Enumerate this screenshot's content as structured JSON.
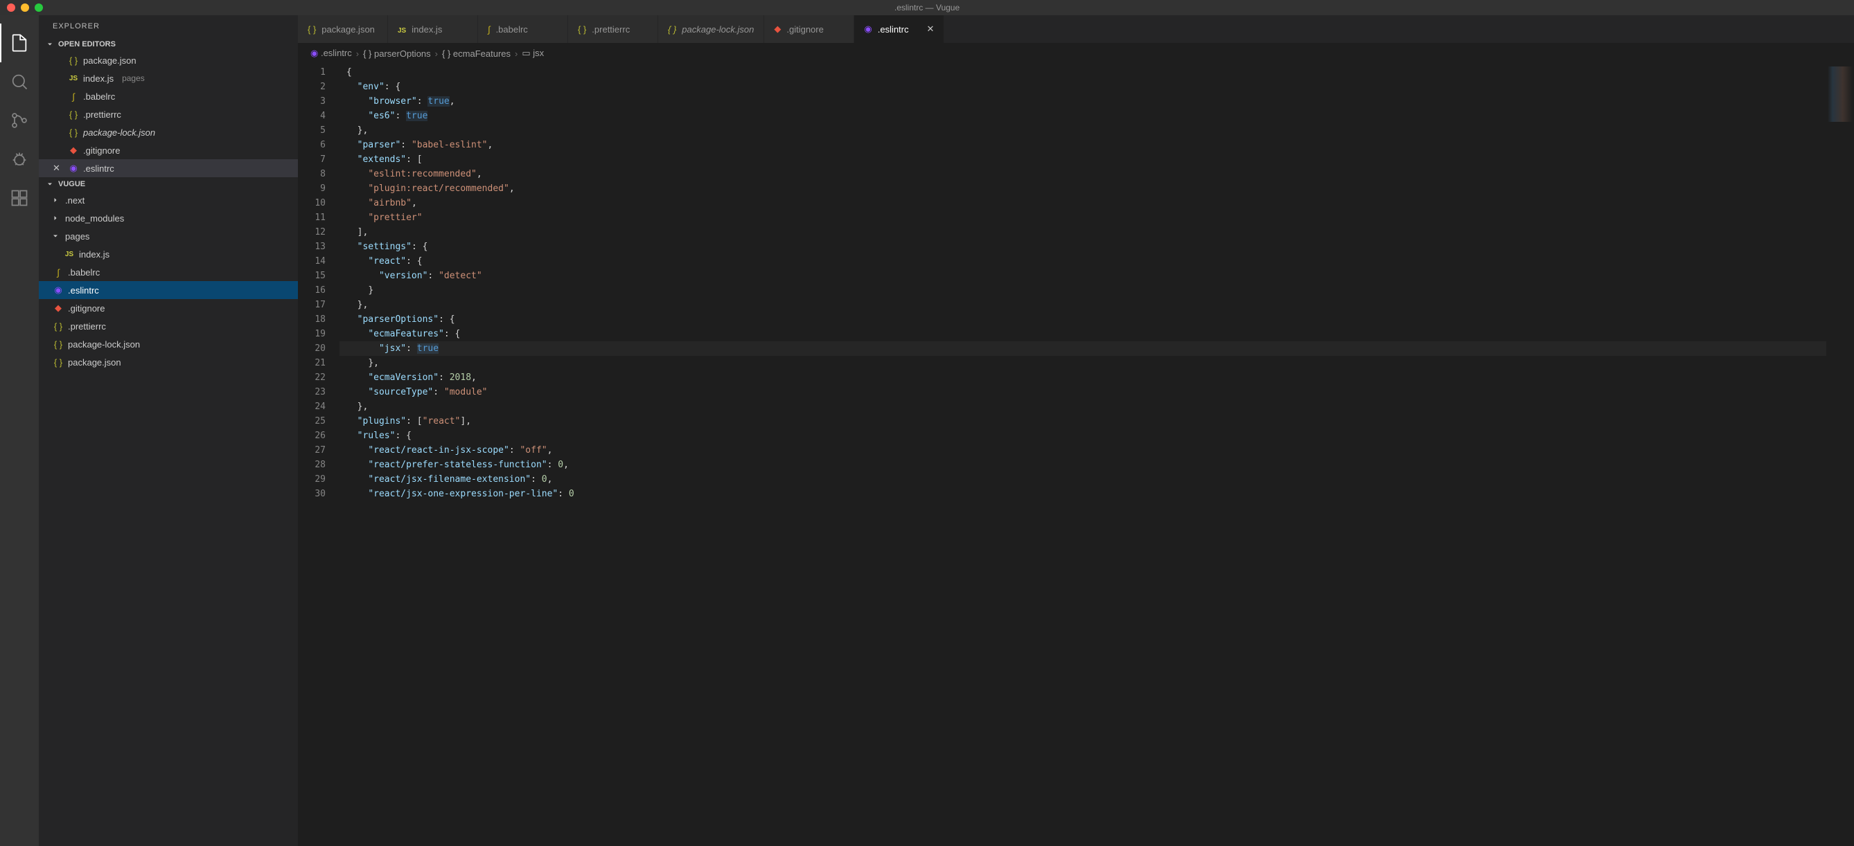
{
  "titlebar": {
    "title": ".eslintrc — Vugue"
  },
  "sidebar": {
    "header": "EXPLORER",
    "sections": {
      "openEditors": {
        "label": "OPEN EDITORS",
        "items": [
          {
            "name": "package.json",
            "iconType": "json"
          },
          {
            "name": "index.js",
            "iconType": "js",
            "hint": "pages"
          },
          {
            "name": ".babelrc",
            "iconType": "babel"
          },
          {
            "name": ".prettierrc",
            "iconType": "json"
          },
          {
            "name": "package-lock.json",
            "iconType": "json",
            "italic": true
          },
          {
            "name": ".gitignore",
            "iconType": "git"
          },
          {
            "name": ".eslintrc",
            "iconType": "eslint",
            "active": true
          }
        ]
      },
      "project": {
        "label": "VUGUE",
        "items": [
          {
            "name": ".next",
            "type": "folder",
            "expanded": false
          },
          {
            "name": "node_modules",
            "type": "folder",
            "expanded": false
          },
          {
            "name": "pages",
            "type": "folder",
            "expanded": true
          },
          {
            "name": "index.js",
            "type": "file",
            "iconType": "js",
            "nested": true
          },
          {
            "name": ".babelrc",
            "type": "file",
            "iconType": "babel"
          },
          {
            "name": ".eslintrc",
            "type": "file",
            "iconType": "eslint",
            "selected": true
          },
          {
            "name": ".gitignore",
            "type": "file",
            "iconType": "git"
          },
          {
            "name": ".prettierrc",
            "type": "file",
            "iconType": "json"
          },
          {
            "name": "package-lock.json",
            "type": "file",
            "iconType": "json"
          },
          {
            "name": "package.json",
            "type": "file",
            "iconType": "json"
          }
        ]
      }
    }
  },
  "tabs": [
    {
      "name": "package.json",
      "iconType": "json"
    },
    {
      "name": "index.js",
      "iconType": "js"
    },
    {
      "name": ".babelrc",
      "iconType": "babel"
    },
    {
      "name": ".prettierrc",
      "iconType": "json"
    },
    {
      "name": "package-lock.json",
      "iconType": "json",
      "italic": true
    },
    {
      "name": ".gitignore",
      "iconType": "git"
    },
    {
      "name": ".eslintrc",
      "iconType": "eslint",
      "active": true
    }
  ],
  "breadcrumbs": [
    {
      "label": ".eslintrc",
      "icon": "eslint"
    },
    {
      "label": "parserOptions",
      "icon": "braces"
    },
    {
      "label": "ecmaFeatures",
      "icon": "braces"
    },
    {
      "label": "jsx",
      "icon": "field"
    }
  ],
  "editor": {
    "currentLine": 20,
    "lines": [
      {
        "n": 1,
        "segs": [
          [
            "{",
            "brace"
          ]
        ]
      },
      {
        "n": 2,
        "segs": [
          [
            "  ",
            ""
          ],
          [
            "\"env\"",
            "key"
          ],
          [
            ": ",
            "punc"
          ],
          [
            "{",
            "brace"
          ]
        ]
      },
      {
        "n": 3,
        "segs": [
          [
            "    ",
            ""
          ],
          [
            "\"browser\"",
            "key"
          ],
          [
            ": ",
            "punc"
          ],
          [
            "true",
            "bool"
          ],
          [
            ",",
            "punc"
          ]
        ]
      },
      {
        "n": 4,
        "segs": [
          [
            "    ",
            ""
          ],
          [
            "\"es6\"",
            "key"
          ],
          [
            ": ",
            "punc"
          ],
          [
            "true",
            "bool"
          ]
        ]
      },
      {
        "n": 5,
        "segs": [
          [
            "  ",
            ""
          ],
          [
            "},",
            "brace"
          ]
        ]
      },
      {
        "n": 6,
        "segs": [
          [
            "  ",
            ""
          ],
          [
            "\"parser\"",
            "key"
          ],
          [
            ": ",
            "punc"
          ],
          [
            "\"babel-eslint\"",
            "str"
          ],
          [
            ",",
            "punc"
          ]
        ]
      },
      {
        "n": 7,
        "segs": [
          [
            "  ",
            ""
          ],
          [
            "\"extends\"",
            "key"
          ],
          [
            ": ",
            "punc"
          ],
          [
            "[",
            "brace"
          ]
        ]
      },
      {
        "n": 8,
        "segs": [
          [
            "    ",
            ""
          ],
          [
            "\"eslint:recommended\"",
            "str"
          ],
          [
            ",",
            "punc"
          ]
        ]
      },
      {
        "n": 9,
        "segs": [
          [
            "    ",
            ""
          ],
          [
            "\"plugin:react/recommended\"",
            "str"
          ],
          [
            ",",
            "punc"
          ]
        ]
      },
      {
        "n": 10,
        "segs": [
          [
            "    ",
            ""
          ],
          [
            "\"airbnb\"",
            "str"
          ],
          [
            ",",
            "punc"
          ]
        ]
      },
      {
        "n": 11,
        "segs": [
          [
            "    ",
            ""
          ],
          [
            "\"prettier\"",
            "str"
          ]
        ]
      },
      {
        "n": 12,
        "segs": [
          [
            "  ",
            ""
          ],
          [
            "],",
            "brace"
          ]
        ]
      },
      {
        "n": 13,
        "segs": [
          [
            "  ",
            ""
          ],
          [
            "\"settings\"",
            "key"
          ],
          [
            ": ",
            "punc"
          ],
          [
            "{",
            "brace"
          ]
        ]
      },
      {
        "n": 14,
        "segs": [
          [
            "    ",
            ""
          ],
          [
            "\"react\"",
            "key"
          ],
          [
            ": ",
            "punc"
          ],
          [
            "{",
            "brace"
          ]
        ]
      },
      {
        "n": 15,
        "segs": [
          [
            "      ",
            ""
          ],
          [
            "\"version\"",
            "key"
          ],
          [
            ": ",
            "punc"
          ],
          [
            "\"detect\"",
            "str"
          ]
        ]
      },
      {
        "n": 16,
        "segs": [
          [
            "    ",
            ""
          ],
          [
            "}",
            "brace"
          ]
        ]
      },
      {
        "n": 17,
        "segs": [
          [
            "  ",
            ""
          ],
          [
            "},",
            "brace"
          ]
        ]
      },
      {
        "n": 18,
        "segs": [
          [
            "  ",
            ""
          ],
          [
            "\"parserOptions\"",
            "key"
          ],
          [
            ": ",
            "punc"
          ],
          [
            "{",
            "brace"
          ]
        ]
      },
      {
        "n": 19,
        "segs": [
          [
            "    ",
            ""
          ],
          [
            "\"ecmaFeatures\"",
            "key"
          ],
          [
            ": ",
            "punc"
          ],
          [
            "{",
            "brace"
          ]
        ]
      },
      {
        "n": 20,
        "segs": [
          [
            "      ",
            ""
          ],
          [
            "\"jsx\"",
            "key"
          ],
          [
            ": ",
            "punc"
          ],
          [
            "true",
            "bool"
          ]
        ],
        "hl": true
      },
      {
        "n": 21,
        "segs": [
          [
            "    ",
            ""
          ],
          [
            "},",
            "brace"
          ]
        ]
      },
      {
        "n": 22,
        "segs": [
          [
            "    ",
            ""
          ],
          [
            "\"ecmaVersion\"",
            "key"
          ],
          [
            ": ",
            "punc"
          ],
          [
            "2018",
            "num"
          ],
          [
            ",",
            "punc"
          ]
        ]
      },
      {
        "n": 23,
        "segs": [
          [
            "    ",
            ""
          ],
          [
            "\"sourceType\"",
            "key"
          ],
          [
            ": ",
            "punc"
          ],
          [
            "\"module\"",
            "str"
          ]
        ]
      },
      {
        "n": 24,
        "segs": [
          [
            "  ",
            ""
          ],
          [
            "},",
            "brace"
          ]
        ]
      },
      {
        "n": 25,
        "segs": [
          [
            "  ",
            ""
          ],
          [
            "\"plugins\"",
            "key"
          ],
          [
            ": ",
            "punc"
          ],
          [
            "[",
            "brace"
          ],
          [
            "\"react\"",
            "str"
          ],
          [
            "],",
            "brace"
          ]
        ]
      },
      {
        "n": 26,
        "segs": [
          [
            "  ",
            ""
          ],
          [
            "\"rules\"",
            "key"
          ],
          [
            ": ",
            "punc"
          ],
          [
            "{",
            "brace"
          ]
        ]
      },
      {
        "n": 27,
        "segs": [
          [
            "    ",
            ""
          ],
          [
            "\"react/react-in-jsx-scope\"",
            "key"
          ],
          [
            ": ",
            "punc"
          ],
          [
            "\"off\"",
            "str"
          ],
          [
            ",",
            "punc"
          ]
        ]
      },
      {
        "n": 28,
        "segs": [
          [
            "    ",
            ""
          ],
          [
            "\"react/prefer-stateless-function\"",
            "key"
          ],
          [
            ": ",
            "punc"
          ],
          [
            "0",
            "num"
          ],
          [
            ",",
            "punc"
          ]
        ]
      },
      {
        "n": 29,
        "segs": [
          [
            "    ",
            ""
          ],
          [
            "\"react/jsx-filename-extension\"",
            "key"
          ],
          [
            ": ",
            "punc"
          ],
          [
            "0",
            "num"
          ],
          [
            ",",
            "punc"
          ]
        ]
      },
      {
        "n": 30,
        "segs": [
          [
            "    ",
            ""
          ],
          [
            "\"react/jsx-one-expression-per-line\"",
            "key"
          ],
          [
            ": ",
            "punc"
          ],
          [
            "0",
            "num"
          ]
        ]
      }
    ]
  }
}
